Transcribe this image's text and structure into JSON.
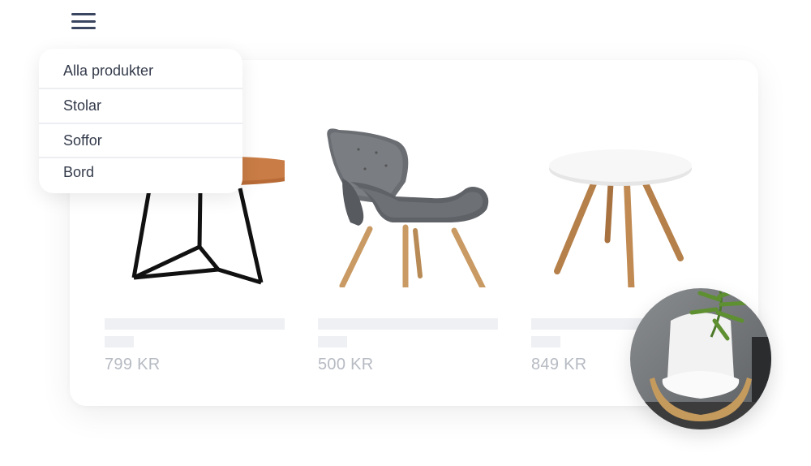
{
  "menu": {
    "items": [
      {
        "label": "Alla produkter"
      },
      {
        "label": "Stolar"
      },
      {
        "label": "Soffor"
      },
      {
        "label": "Bord"
      }
    ]
  },
  "products": [
    {
      "price": "799 KR",
      "image": "side-table-image"
    },
    {
      "price": "500 KR",
      "image": "armchair-image"
    },
    {
      "price": "849 KR",
      "image": "round-table-image"
    }
  ],
  "colors": {
    "menu_icon": "#3a4560",
    "price_text": "#b6bac2",
    "placeholder_bar": "#eef0f3",
    "menu_text": "#333a4a"
  }
}
